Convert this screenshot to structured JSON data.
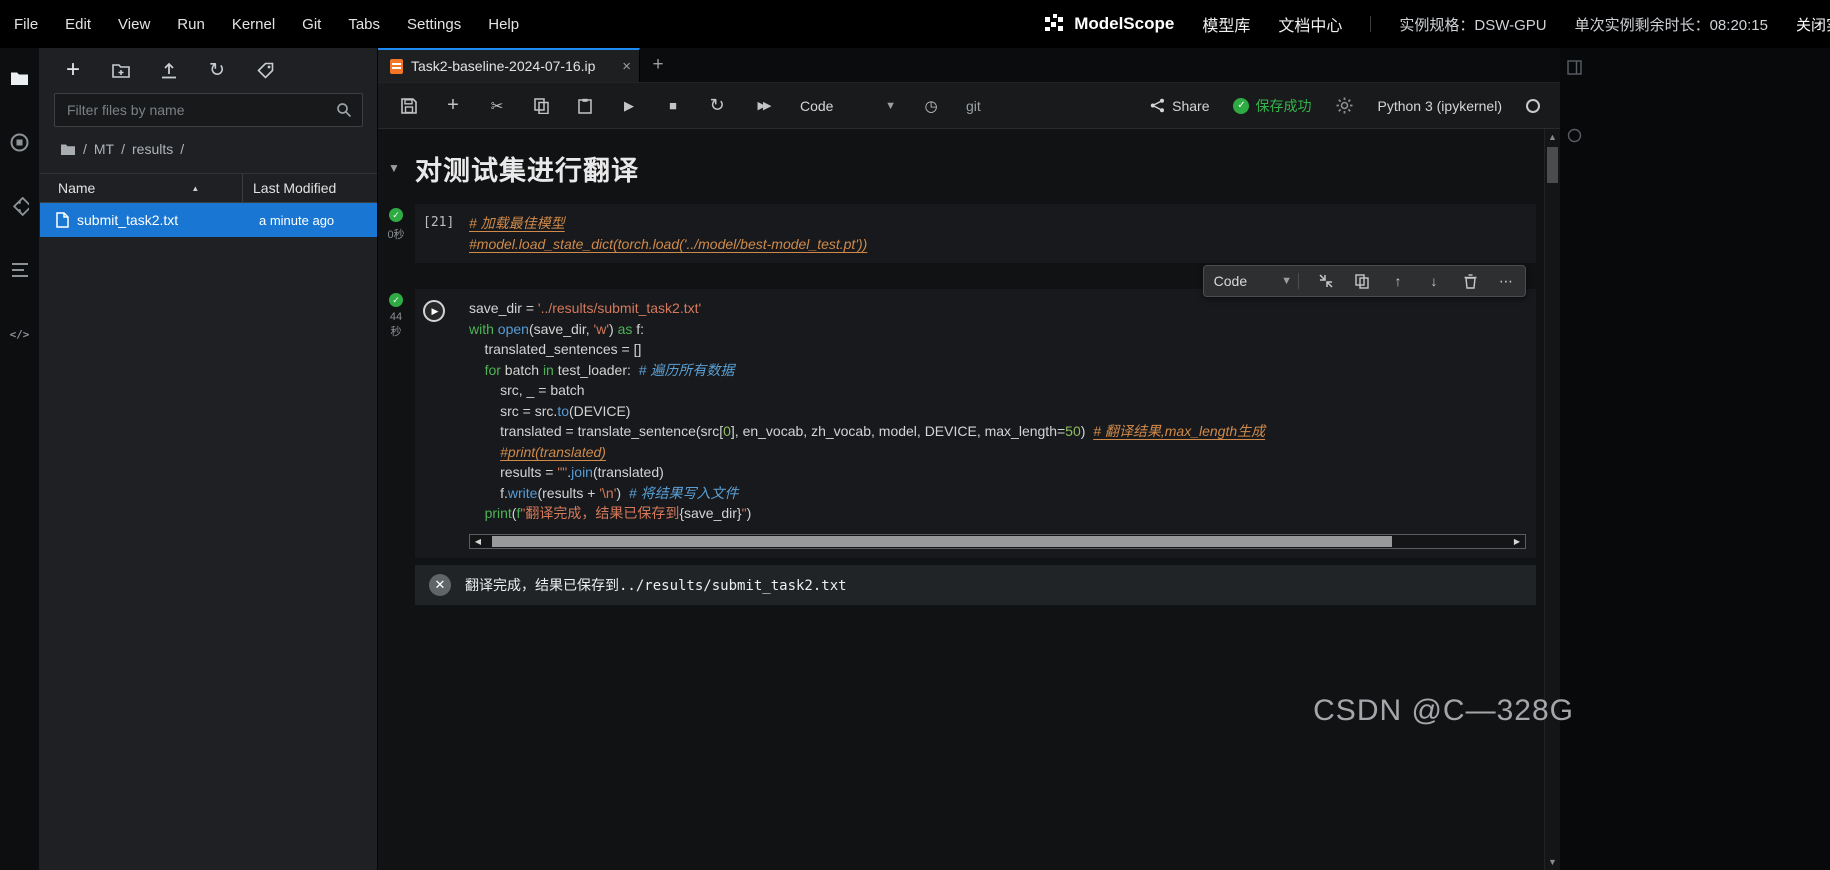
{
  "menubar": {
    "items": [
      "File",
      "Edit",
      "View",
      "Run",
      "Kernel",
      "Git",
      "Tabs",
      "Settings",
      "Help"
    ],
    "brand": "ModelScope",
    "link_model_hub": "模型库",
    "link_docs": "文档中心",
    "instance_spec": "实例规格：DSW-GPU",
    "remaining_time": "单次实例剩余时长：08:20:15",
    "close_instance": "关闭实例"
  },
  "filebrowser": {
    "filter_placeholder": "Filter files by name",
    "breadcrumb": {
      "sep": "/",
      "parts": [
        "MT",
        "results"
      ]
    },
    "columns": {
      "name": "Name",
      "modified": "Last Modified"
    },
    "rows": [
      {
        "name": "submit_task2.txt",
        "modified": "a minute ago"
      }
    ]
  },
  "tabbar": {
    "active_tab": "Task2-baseline-2024-07-16.ip"
  },
  "toolbar": {
    "mode": "Code",
    "git_label": "git",
    "share_label": "Share",
    "save_status": "保存成功",
    "kernel_name": "Python 3 (ipykernel)"
  },
  "notebook": {
    "heading": "对测试集进行翻译",
    "cell_toolbar": {
      "mode": "Code"
    },
    "cells": [
      {
        "prompt": "[21]",
        "time": "0秒",
        "lines": [
          [
            [
              "# 加载最佳模型",
              "l"
            ]
          ],
          [
            [
              "#model.load_state_dict(torch.load('../model/best-model_test.pt'))",
              "l"
            ]
          ]
        ]
      },
      {
        "time_top": "44",
        "time_bottom": "秒",
        "lines": [
          [
            [
              "save_dir ",
              "p"
            ],
            [
              "= ",
              "p"
            ],
            [
              "'../results/submit_task2.txt'",
              "s"
            ]
          ],
          [
            [
              "with",
              "k"
            ],
            [
              " ",
              "p"
            ],
            [
              "open",
              "b"
            ],
            [
              "(save_dir, ",
              "p"
            ],
            [
              "'w'",
              "s"
            ],
            [
              ") ",
              "p"
            ],
            [
              "as",
              "k"
            ],
            [
              " f:",
              "p"
            ]
          ],
          [
            [
              "    translated_sentences ",
              "p"
            ],
            [
              "= []",
              "p"
            ]
          ],
          [
            [
              "    ",
              "p"
            ],
            [
              "for",
              "k"
            ],
            [
              " batch ",
              "p"
            ],
            [
              "in",
              "k"
            ],
            [
              " test_loader:  ",
              "p"
            ],
            [
              "# 遍历所有数据",
              "c"
            ]
          ],
          [
            [
              "        src, _ ",
              "p"
            ],
            [
              "= ",
              "p"
            ],
            [
              "batch",
              "p"
            ]
          ],
          [
            [
              "        src ",
              "p"
            ],
            [
              "= ",
              "p"
            ],
            [
              "src.",
              "p"
            ],
            [
              "to",
              "b"
            ],
            [
              "(DEVICE)",
              "p"
            ]
          ],
          [
            [
              "        translated ",
              "p"
            ],
            [
              "= ",
              "p"
            ],
            [
              "translate_sentence(src[",
              "p"
            ],
            [
              "0",
              "n"
            ],
            [
              "], en_vocab, zh_vocab, model, DEVICE, max_length=",
              "p"
            ],
            [
              "50",
              "n"
            ],
            [
              ")  ",
              "p"
            ],
            [
              "# 翻译结果,max_length生成",
              "l"
            ]
          ],
          [
            [
              "        ",
              "p"
            ],
            [
              "#print(translated)",
              "l"
            ]
          ],
          [
            [
              "        results ",
              "p"
            ],
            [
              "= ",
              "p"
            ],
            [
              "\"\"",
              "s"
            ],
            [
              ".",
              "p"
            ],
            [
              "join",
              "b"
            ],
            [
              "(translated)",
              "p"
            ]
          ],
          [
            [
              "        f.",
              "p"
            ],
            [
              "write",
              "b"
            ],
            [
              "(results ",
              "p"
            ],
            [
              "+ ",
              "p"
            ],
            [
              "'\\n'",
              "s"
            ],
            [
              ")  ",
              "p"
            ],
            [
              "# 将结果写入文件",
              "c"
            ]
          ],
          [
            [
              "    ",
              "p"
            ],
            [
              "print",
              "k"
            ],
            [
              "(",
              "p"
            ],
            [
              "f",
              "k"
            ],
            [
              "\"翻译完成，结果已保存到",
              "s"
            ],
            [
              "{save_dir}",
              "p"
            ],
            [
              "\"",
              "s"
            ],
            [
              ")",
              "p"
            ]
          ]
        ],
        "output": "翻译完成，结果已保存到../results/submit_task2.txt"
      }
    ]
  },
  "watermark": "CSDN @C—328G"
}
